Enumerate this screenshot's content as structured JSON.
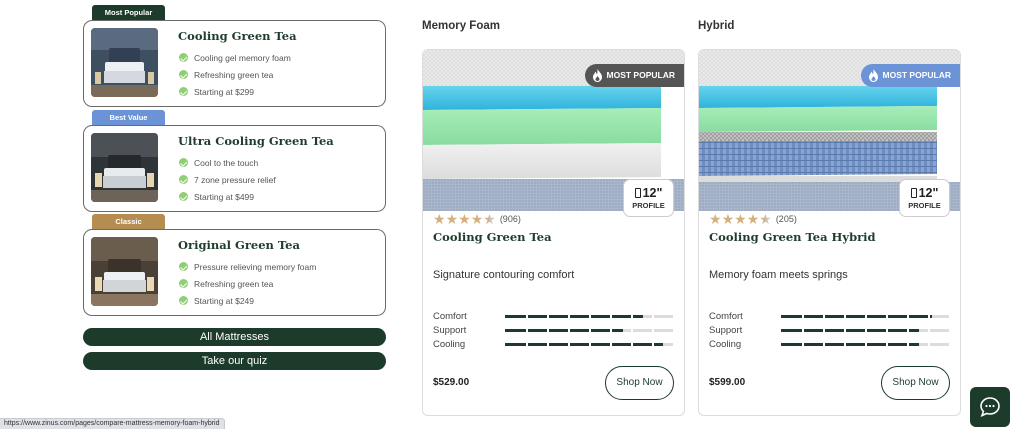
{
  "mattress_list": {
    "items": [
      {
        "badge": "Most Popular",
        "badge_color": "#1d3b2b",
        "name": "Cooling Green Tea",
        "features": [
          "Cooling gel memory foam",
          "Refreshing green tea",
          "Starting at $299"
        ]
      },
      {
        "badge": "Best Value",
        "badge_color": "#6b93d6",
        "name": "Ultra Cooling Green Tea",
        "features": [
          "Cool to the touch",
          "7 zone pressure relief",
          "Starting at $499"
        ]
      },
      {
        "badge": "Classic",
        "badge_color": "#b68d50",
        "name": "Original Green Tea",
        "features": [
          "Pressure relieving memory foam",
          "Refreshing green tea",
          "Starting at $249"
        ]
      }
    ],
    "all_button": "All Mattresses",
    "quiz_button": "Take our quiz"
  },
  "compare": {
    "columns": [
      {
        "title": "Memory Foam",
        "badge": "MOST POPULAR",
        "badge_color": "#555555",
        "profile_value": "12\"",
        "profile_label": "PROFILE",
        "rating": 4.5,
        "reviews": "(906)",
        "name": "Cooling Green Tea",
        "tagline": "Signature contouring comfort",
        "ratings": [
          {
            "label": "Comfort",
            "level": 0.82
          },
          {
            "label": "Support",
            "level": 0.7
          },
          {
            "label": "Cooling",
            "level": 0.94
          }
        ],
        "price": "$529.00",
        "shop_button": "Shop Now"
      },
      {
        "title": "Hybrid",
        "badge": "MOST POPULAR",
        "badge_color": "#6b93d6",
        "profile_value": "12\"",
        "profile_label": "PROFILE",
        "rating": 4.5,
        "reviews": "(205)",
        "name": "Cooling Green Tea Hybrid",
        "tagline": "Memory foam meets springs",
        "ratings": [
          {
            "label": "Comfort",
            "level": 0.9
          },
          {
            "label": "Support",
            "level": 0.82
          },
          {
            "label": "Cooling",
            "level": 0.82
          }
        ],
        "price": "$599.00",
        "shop_button": "Shop Now"
      }
    ]
  },
  "status_bar": {
    "url": "https://www.zinus.com/pages/compare-mattress-memory-foam-hybrid"
  },
  "chat": {
    "icon": "chat-bubble-icon"
  }
}
